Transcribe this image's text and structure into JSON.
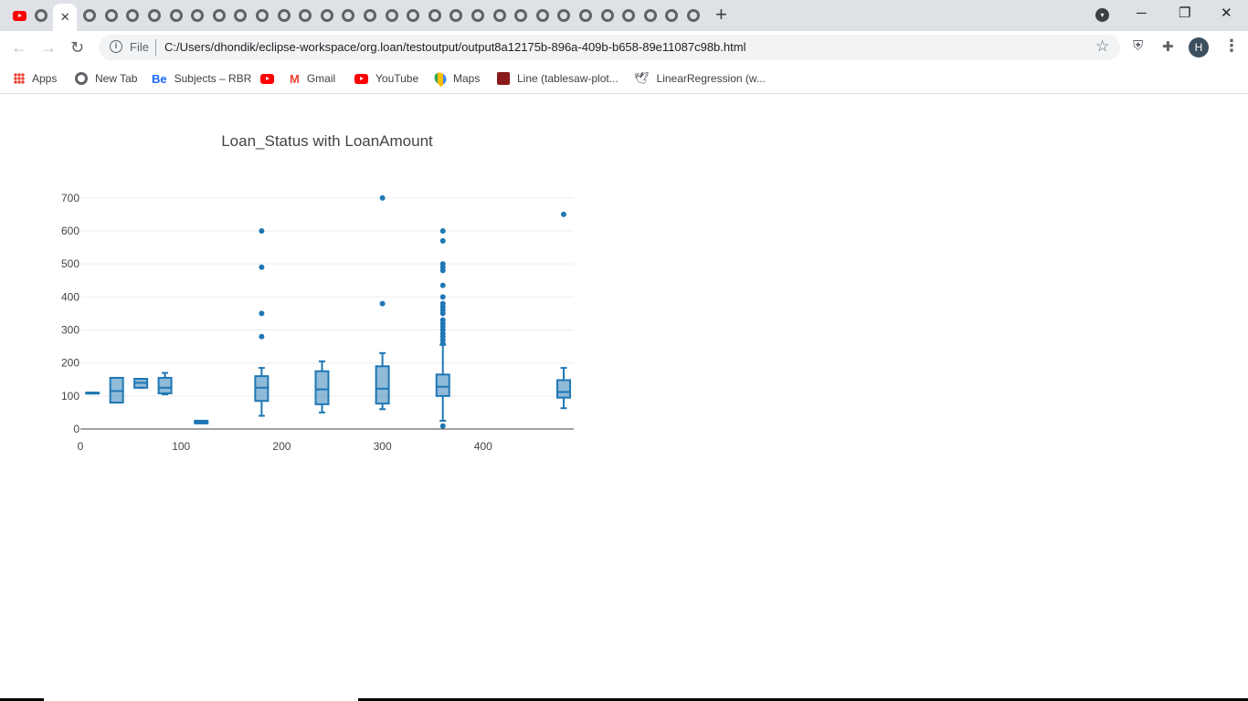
{
  "browser": {
    "tabs": [
      {
        "icon": "youtube-icon",
        "active": false
      },
      {
        "icon": "globe-icon",
        "active": false
      },
      {
        "icon": "close-icon",
        "active": true
      },
      {
        "icon": "globe-icon",
        "active": false
      },
      {
        "icon": "globe-icon",
        "active": false
      },
      {
        "icon": "globe-icon",
        "active": false
      },
      {
        "icon": "globe-icon",
        "active": false
      },
      {
        "icon": "globe-icon",
        "active": false
      },
      {
        "icon": "globe-icon",
        "active": false
      },
      {
        "icon": "globe-icon",
        "active": false
      },
      {
        "icon": "globe-icon",
        "active": false
      },
      {
        "icon": "globe-icon",
        "active": false
      },
      {
        "icon": "globe-icon",
        "active": false
      },
      {
        "icon": "globe-icon",
        "active": false
      },
      {
        "icon": "globe-icon",
        "active": false
      },
      {
        "icon": "globe-icon",
        "active": false
      },
      {
        "icon": "globe-icon",
        "active": false
      },
      {
        "icon": "globe-icon",
        "active": false
      },
      {
        "icon": "globe-icon",
        "active": false
      },
      {
        "icon": "globe-icon",
        "active": false
      },
      {
        "icon": "globe-icon",
        "active": false
      },
      {
        "icon": "globe-icon",
        "active": false
      },
      {
        "icon": "globe-icon",
        "active": false
      },
      {
        "icon": "globe-icon",
        "active": false
      },
      {
        "icon": "globe-icon",
        "active": false
      },
      {
        "icon": "globe-icon",
        "active": false
      },
      {
        "icon": "globe-icon",
        "active": false
      },
      {
        "icon": "globe-icon",
        "active": false
      },
      {
        "icon": "globe-icon",
        "active": false
      },
      {
        "icon": "globe-icon",
        "active": false
      },
      {
        "icon": "globe-icon",
        "active": false
      },
      {
        "icon": "globe-icon",
        "active": false
      }
    ],
    "new_tab_label": "+",
    "address_bar": {
      "scheme_label": "File",
      "url": "C:/Users/dhondik/eclipse-workspace/org.loan/testoutput/output8a12175b-896a-409b-b658-89e11087c98b.html"
    },
    "profile_initial": "H",
    "bookmarks": [
      {
        "label": "Apps",
        "icon": "apps-grid-icon"
      },
      {
        "label": "New Tab",
        "icon": "globe-icon"
      },
      {
        "label": "Subjects – RBR",
        "icon": "behance-icon"
      },
      {
        "label": "",
        "icon": "youtube-icon"
      },
      {
        "label": "Gmail",
        "icon": "gmail-icon"
      },
      {
        "label": "YouTube",
        "icon": "youtube-icon"
      },
      {
        "label": "Maps",
        "icon": "maps-icon"
      },
      {
        "label": "Line (tablesaw-plot...",
        "icon": "book-icon"
      },
      {
        "label": "LinearRegression (w...",
        "icon": "bird-icon"
      }
    ],
    "accent_color": "#1f77b4"
  },
  "chart_data": {
    "type": "box",
    "title": "Loan_Status with LoanAmount",
    "xlabel": "",
    "ylabel": "",
    "xlim": [
      0,
      490
    ],
    "ylim": [
      0,
      730
    ],
    "x_ticks": [
      0,
      100,
      200,
      300,
      400
    ],
    "y_ticks": [
      0,
      100,
      200,
      300,
      400,
      500,
      600,
      700
    ],
    "grid": true,
    "color": "#1f77b4",
    "boxes": [
      {
        "x": 12,
        "min": 110,
        "q1": 110,
        "median": 110,
        "q3": 110,
        "max": 110,
        "outliers": []
      },
      {
        "x": 36,
        "min": 80,
        "q1": 80,
        "median": 115,
        "q3": 155,
        "max": 155,
        "outliers": []
      },
      {
        "x": 60,
        "min": 125,
        "q1": 125,
        "median": 140,
        "q3": 152,
        "max": 152,
        "outliers": []
      },
      {
        "x": 84,
        "min": 105,
        "q1": 108,
        "median": 125,
        "q3": 155,
        "max": 170,
        "outliers": []
      },
      {
        "x": 120,
        "min": 17,
        "q1": 17,
        "median": 22,
        "q3": 25,
        "max": 25,
        "outliers": []
      },
      {
        "x": 180,
        "min": 40,
        "q1": 85,
        "median": 125,
        "q3": 160,
        "max": 185,
        "outliers": [
          280,
          350,
          490,
          600
        ]
      },
      {
        "x": 240,
        "min": 50,
        "q1": 75,
        "median": 120,
        "q3": 175,
        "max": 205,
        "outliers": []
      },
      {
        "x": 300,
        "min": 60,
        "q1": 77,
        "median": 122,
        "q3": 190,
        "max": 230,
        "outliers": [
          380,
          700
        ]
      },
      {
        "x": 360,
        "min": 25,
        "q1": 100,
        "median": 128,
        "q3": 165,
        "max": 255,
        "outliers": [
          9,
          260,
          270,
          280,
          290,
          300,
          310,
          320,
          330,
          350,
          360,
          370,
          380,
          400,
          435,
          480,
          490,
          500,
          570,
          600
        ]
      },
      {
        "x": 480,
        "min": 63,
        "q1": 95,
        "median": 112,
        "q3": 148,
        "max": 185,
        "outliers": [
          650
        ]
      }
    ]
  }
}
